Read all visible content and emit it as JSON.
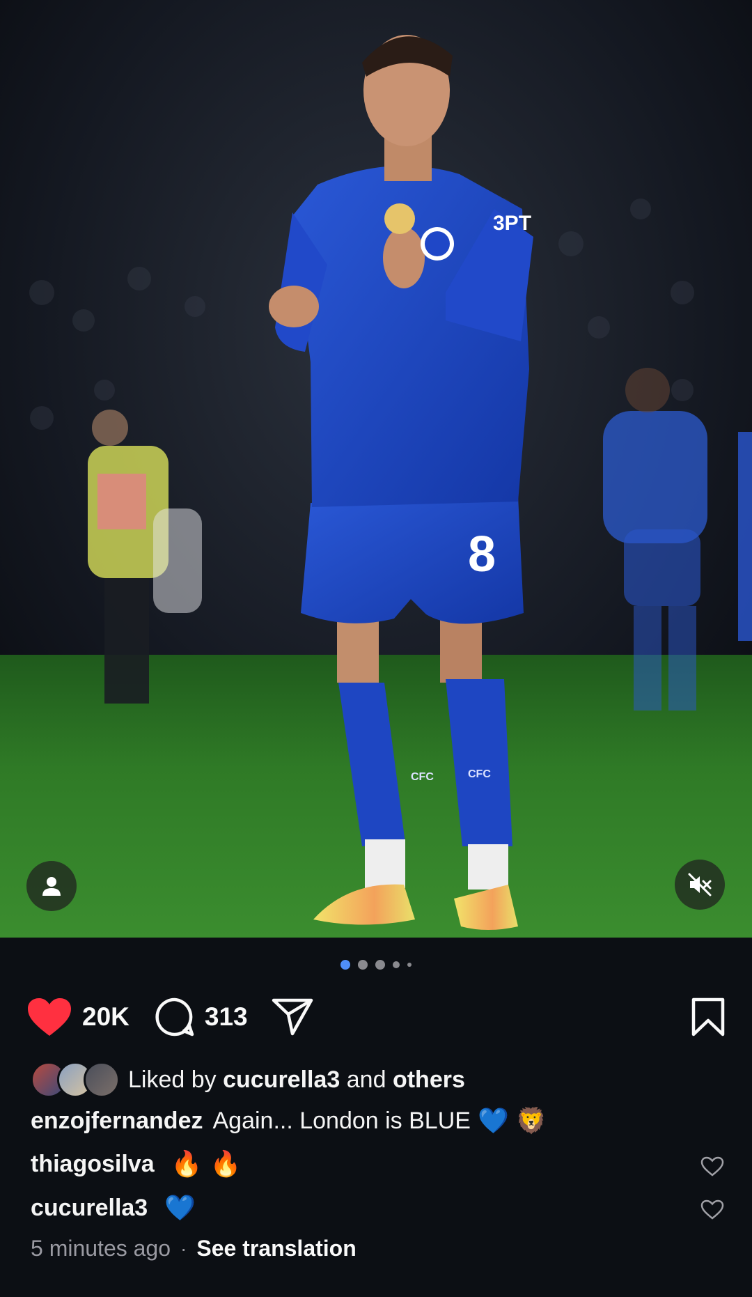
{
  "post": {
    "image_alt": "Footballer in blue kit applauding on the pitch",
    "kit_number": "8",
    "crest_text": "CFC",
    "sponsor_text": "3PT"
  },
  "carousel": {
    "count": 5,
    "active_index": 0
  },
  "actions": {
    "likes_count": "20K",
    "comments_count": "313",
    "like_icon": "heart-filled-icon",
    "comment_icon": "comment-bubble-icon",
    "share_icon": "send-icon",
    "save_icon": "bookmark-icon"
  },
  "likes": {
    "prefix": "Liked by",
    "user": "cucurella3",
    "joiner": "and",
    "others": "others"
  },
  "caption": {
    "username": "enzojfernandez",
    "text": "Again... London is BLUE",
    "emojis": [
      "💙",
      "🦁"
    ]
  },
  "comments": [
    {
      "username": "thiagosilva",
      "text": "🔥 🔥"
    },
    {
      "username": "cucurella3",
      "text": "💙"
    }
  ],
  "meta": {
    "time": "5 minutes ago",
    "separator": "·",
    "translation": "See translation"
  },
  "colors": {
    "background": "#0c0f14",
    "like_red": "#ff3040",
    "active_dot": "#4f8ef7",
    "muted_text": "#9a9aa2"
  }
}
